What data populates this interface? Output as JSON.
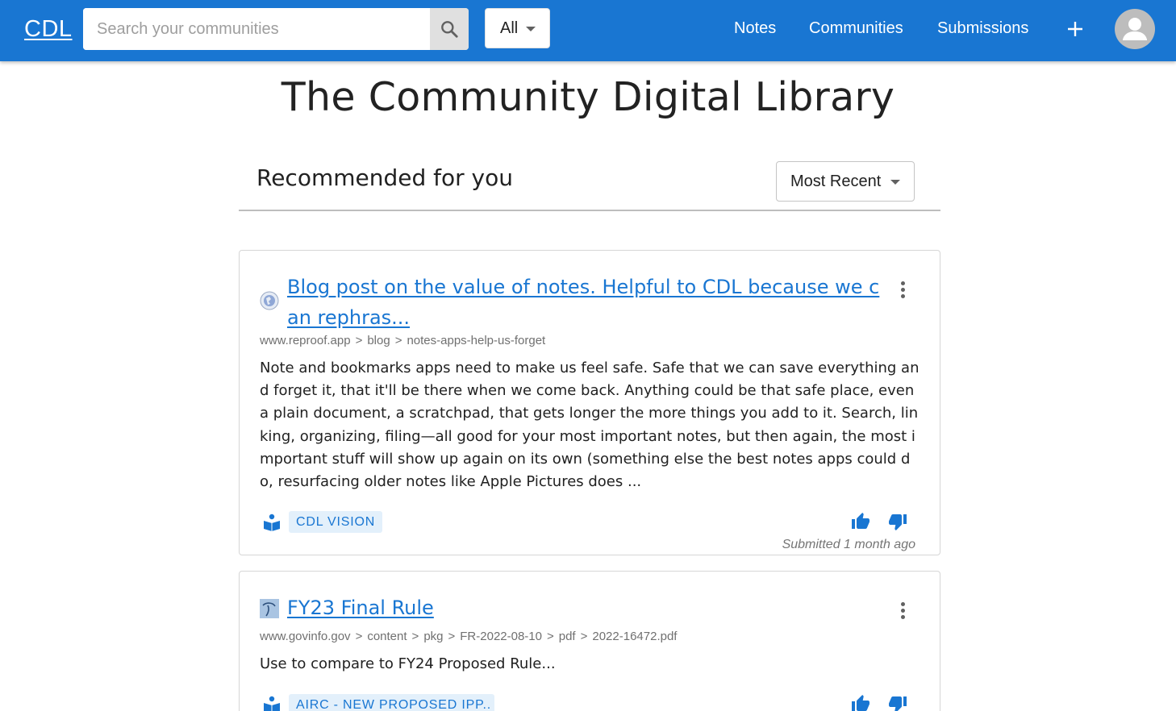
{
  "header": {
    "logo": "CDL",
    "search": {
      "placeholder": "Search your communities",
      "value": ""
    },
    "filter": {
      "selected": "All"
    },
    "nav": {
      "notes": "Notes",
      "communities": "Communities",
      "submissions": "Submissions"
    },
    "icons": [
      "search-icon",
      "chevron-down-icon",
      "plus-icon",
      "account-avatar-icon"
    ],
    "colors": {
      "bar": "#1976d2"
    }
  },
  "main": {
    "title": "The Community Digital Library",
    "section_title": "Recommended for you",
    "sort": {
      "selected": "Most Recent"
    }
  },
  "cards": [
    {
      "title": "Blog post on the value of notes. Helpful to CDL because we can rephras...",
      "breadcrumb": [
        "www.reproof.app",
        "blog",
        "notes-apps-help-us-forget"
      ],
      "description": "Note and bookmarks apps need to make us feel safe. Safe that we can save everything and forget it, that it'll be there when we come back. Anything could be that safe place, even a plain document, a scratchpad, that gets longer the more things you add to it. Search, linking, organizing, filing—all good for your most important notes, but then again, the most important stuff will show up again on its own (something else the best notes apps could do, resurfacing older notes like Apple Pictures does ...",
      "community": "CDL VISION",
      "submitted": "Submitted 1 month ago"
    },
    {
      "title": "FY23 Final Rule",
      "breadcrumb": [
        "www.govinfo.gov",
        "content",
        "pkg",
        "FR-2022-08-10",
        "pdf",
        "2022-16472.pdf"
      ],
      "description": "Use to compare to FY24 Proposed Rule...",
      "community": "AIRC - NEW PROPOSED IPP..",
      "submitted": ""
    }
  ]
}
